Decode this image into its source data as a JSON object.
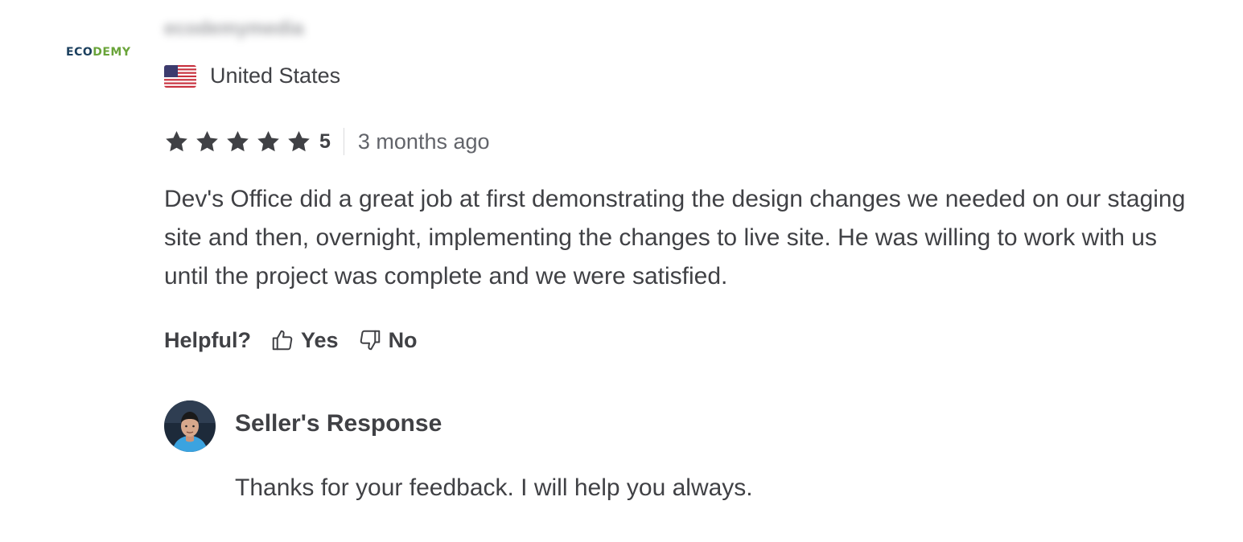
{
  "reviewer": {
    "company_logo": {
      "part1": "ECO",
      "part2": "DEMY"
    },
    "username": "ecodemymedia",
    "country": "United States",
    "flag_icon": "us-flag-icon"
  },
  "rating": {
    "stars": 5,
    "max_stars": 5,
    "score_label": "5",
    "time_ago": "3 months ago",
    "star_color": "#404145"
  },
  "review": {
    "text": "Dev's Office did a great job at first demonstrating the design changes we needed on our staging site and then, overnight, implementing the changes to live site. He was willing to work with us until the project was complete and we were satisfied."
  },
  "helpful": {
    "label": "Helpful?",
    "yes_label": "Yes",
    "no_label": "No",
    "yes_icon": "thumbs-up-icon",
    "no_icon": "thumbs-down-icon"
  },
  "seller_response": {
    "title": "Seller's Response",
    "text": "Thanks for your feedback. I will help you always.",
    "avatar_icon": "seller-avatar"
  },
  "colors": {
    "text": "#404145",
    "muted": "#62646a",
    "logo_dark": "#1b3f5e",
    "logo_green": "#6aa43a"
  }
}
